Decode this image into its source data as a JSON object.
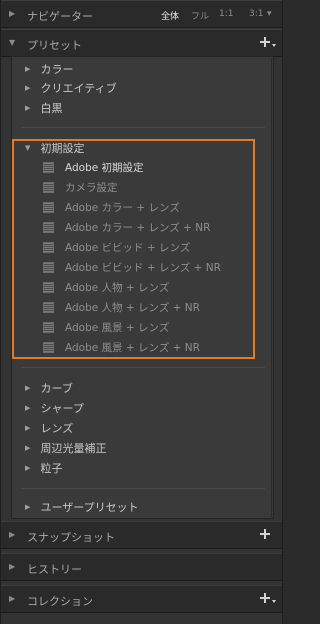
{
  "navigator": {
    "title": "ナビゲーター",
    "zoom": [
      "全体",
      "フル",
      "1:1",
      "3:1"
    ],
    "zoom_dropdown": "▾"
  },
  "presets": {
    "title": "プリセット",
    "top_folders": [
      "カラー",
      "クリエイティブ",
      "白黒"
    ],
    "expanded_folder": "初期設定",
    "items": [
      "Adobe 初期設定",
      "カメラ設定",
      "Adobe カラー + レンズ",
      "Adobe カラー + レンズ + NR",
      "Adobe ビビッド + レンズ",
      "Adobe ビビッド + レンズ + NR",
      "Adobe 人物 + レンズ",
      "Adobe 人物 + レンズ + NR",
      "Adobe 風景 + レンズ",
      "Adobe 風景 + レンズ + NR"
    ],
    "bottom_folders": [
      "カーブ",
      "シャープ",
      "レンズ",
      "周辺光量補正",
      "粒子"
    ],
    "user_folder": "ユーザープリセット"
  },
  "snapshots": {
    "title": "スナップショット"
  },
  "history": {
    "title": "ヒストリー"
  },
  "collections": {
    "title": "コレクション"
  },
  "colors": {
    "highlight_border": "#e07b28",
    "panel_bg": "#333333",
    "header_bg": "#2a2a2a"
  }
}
